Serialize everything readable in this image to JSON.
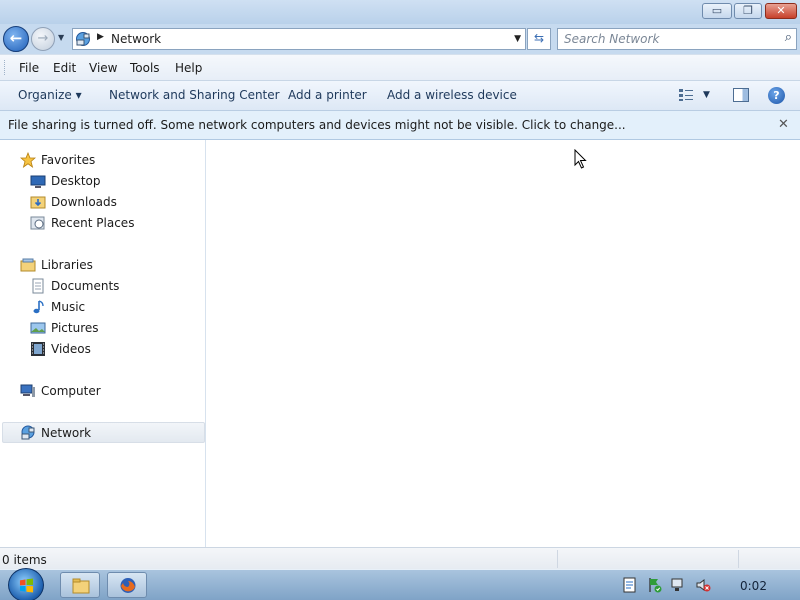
{
  "window": {
    "title_buttons": {
      "minimize": "▭",
      "maximize": "❐",
      "close": "✕"
    }
  },
  "address": {
    "location": "Network",
    "search_placeholder": "Search Network"
  },
  "menu": {
    "file": "File",
    "edit": "Edit",
    "view": "View",
    "tools": "Tools",
    "help": "Help"
  },
  "commands": {
    "organize": "Organize ▾",
    "network_center": "Network and Sharing Center",
    "add_printer": "Add a printer",
    "add_wireless": "Add a wireless device"
  },
  "infobar": {
    "message": "File sharing is turned off. Some network computers and devices might not be visible. Click to change..."
  },
  "nav": {
    "favorites": "Favorites",
    "desktop": "Desktop",
    "downloads": "Downloads",
    "recent": "Recent Places",
    "libraries": "Libraries",
    "documents": "Documents",
    "music": "Music",
    "pictures": "Pictures",
    "videos": "Videos",
    "computer": "Computer",
    "network": "Network"
  },
  "status": {
    "items": "0 items"
  },
  "taskbar": {
    "clock": "0:02"
  },
  "colors": {
    "accent": "#1e395b",
    "infobar": "#e3f0fb",
    "taskbar": "#7fa3c7"
  },
  "icons": {
    "nav_back": "back-arrow-icon",
    "nav_forward": "forward-arrow-icon",
    "search": "magnifier-icon",
    "help": "help-icon"
  }
}
